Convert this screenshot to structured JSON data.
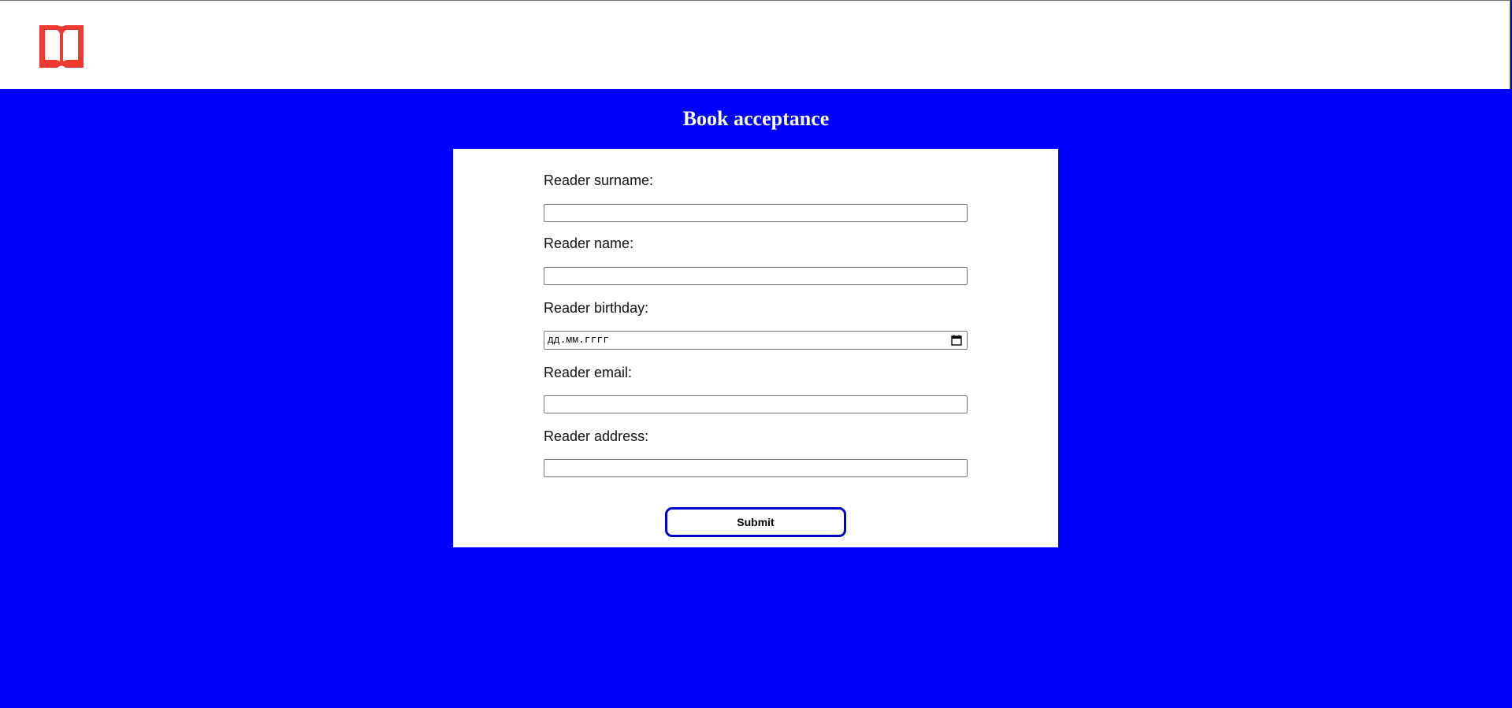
{
  "header": {
    "logo_icon": "open-book-icon",
    "logo_color": "#ee3b2f"
  },
  "page": {
    "title": "Book acceptance",
    "background_color": "#0000ff"
  },
  "form": {
    "fields": [
      {
        "label": "Reader surname:",
        "value": "",
        "type": "text"
      },
      {
        "label": "Reader name:",
        "value": "",
        "type": "text"
      },
      {
        "label": "Reader birthday:",
        "value": "",
        "type": "date",
        "placeholder": "дд.мм.гггг",
        "icon": "calendar-icon"
      },
      {
        "label": "Reader email:",
        "value": "",
        "type": "text"
      },
      {
        "label": "Reader address:",
        "value": "",
        "type": "text"
      }
    ],
    "submit_label": "Submit",
    "submit_border_color": "#0000cd"
  }
}
